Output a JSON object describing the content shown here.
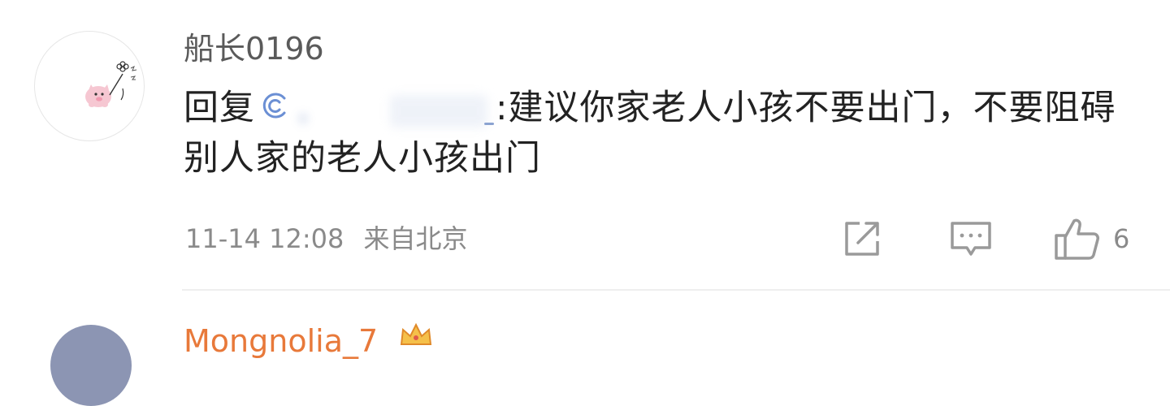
{
  "comment": {
    "username": "船长0196",
    "reply_prefix": "回复",
    "mention_separator": ":",
    "content_text": "建议你家老人小孩不要出门，不要阻碍别人家的老人小孩出门",
    "time": "11-14 12:08",
    "location": "来自北京",
    "like_count": "6"
  },
  "next_comment": {
    "username": "Mongnolia_7"
  },
  "icons": {
    "avatar": "avatar",
    "mention": "mention-icon",
    "share": "share-icon",
    "reply": "comment-icon",
    "like": "thumbs-up-icon",
    "vip": "crown-icon"
  }
}
